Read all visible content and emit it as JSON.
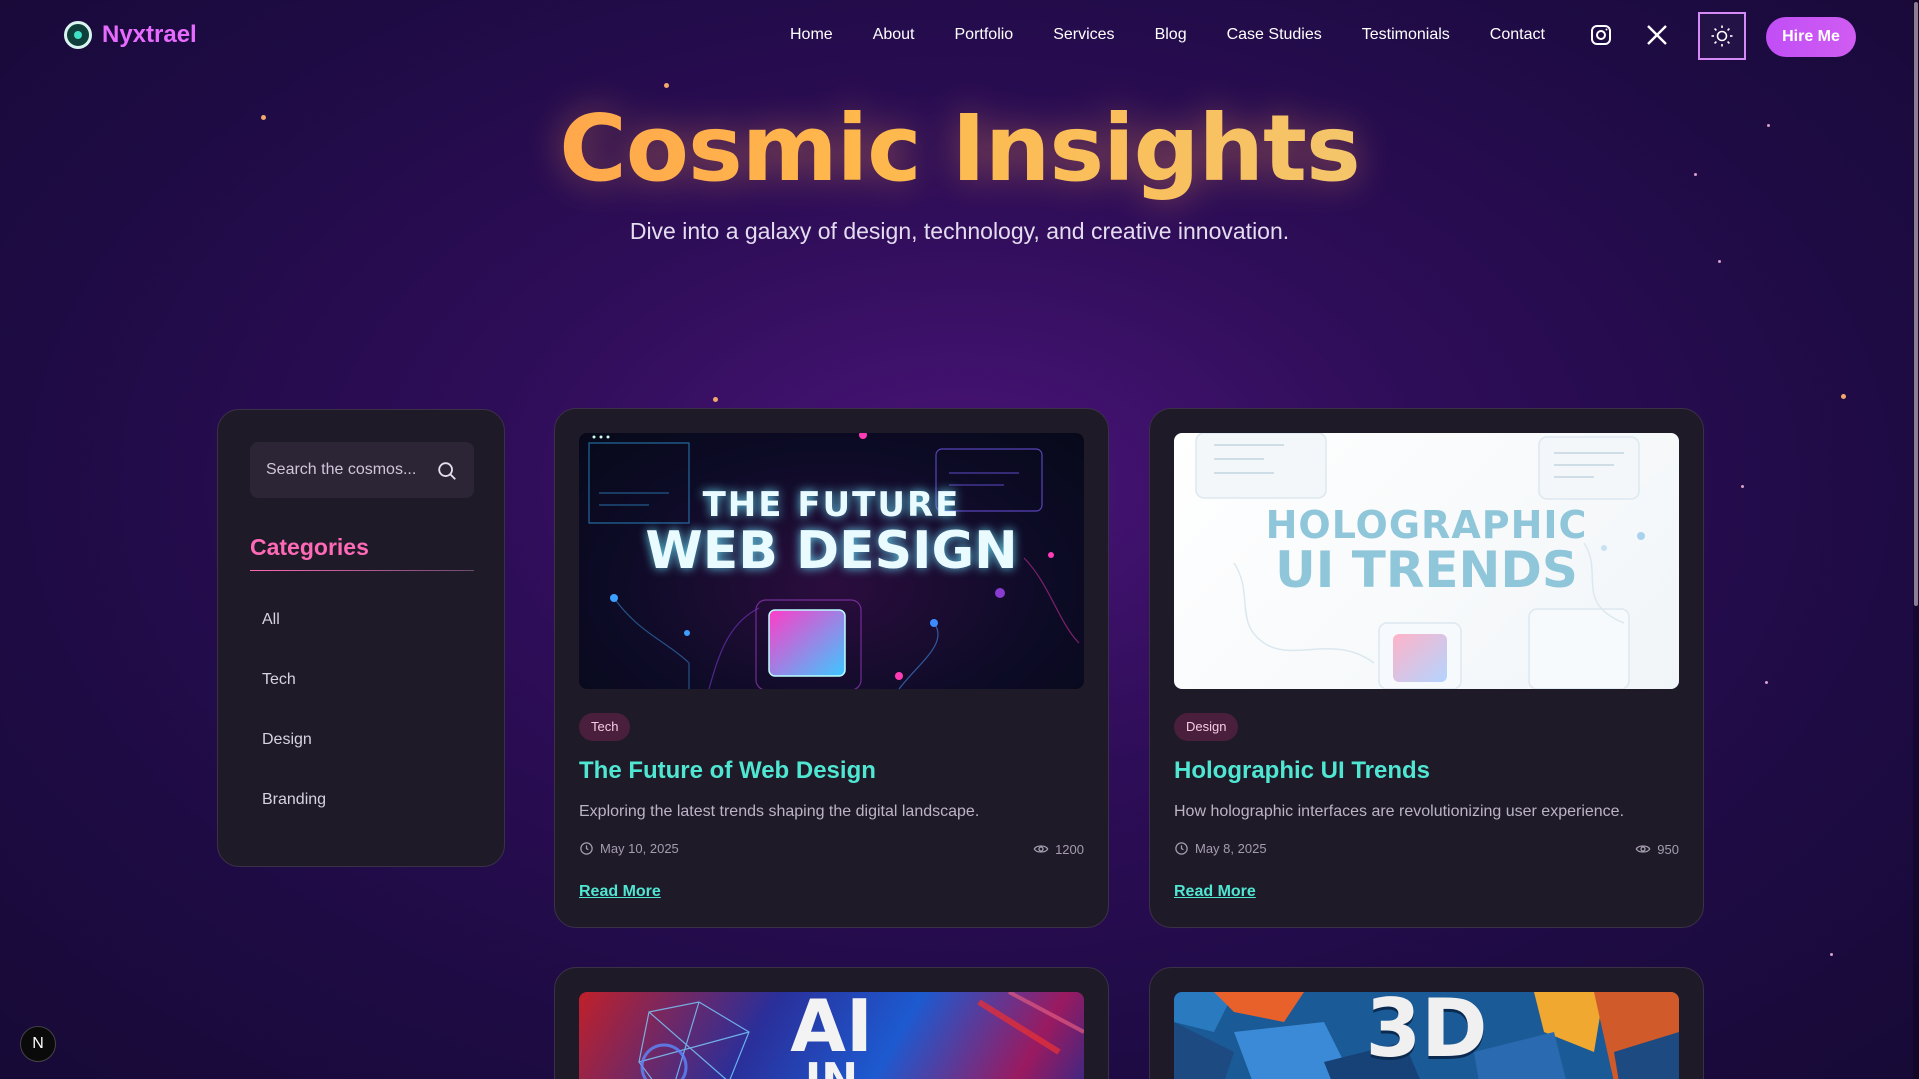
{
  "brand": {
    "name": "Nyxtrael"
  },
  "nav": {
    "links": [
      "Home",
      "About",
      "Portfolio",
      "Services",
      "Blog",
      "Case Studies",
      "Testimonials",
      "Contact"
    ],
    "instagram_icon": "instagram-icon",
    "x_icon": "x-icon",
    "theme_icon": "sun-icon",
    "hire_label": "Hire Me"
  },
  "hero": {
    "title": "Cosmic Insights",
    "subtitle": "Dive into a galaxy of design, technology, and creative innovation."
  },
  "sidebar": {
    "search_placeholder": "Search the cosmos...",
    "categories_title": "Categories",
    "categories": [
      "All",
      "Tech",
      "Design",
      "Branding"
    ]
  },
  "posts": [
    {
      "tag": "Tech",
      "title": "The Future of Web Design",
      "description": "Exploring the latest trends shaping the digital landscape.",
      "date": "May 10, 2025",
      "views": "1200",
      "read_more": "Read More",
      "image_line1": "THE FUTURE",
      "image_line2": "WEB DESIGN"
    },
    {
      "tag": "Design",
      "title": "Holographic UI Trends",
      "description": "How holographic interfaces are revolutionizing user experience.",
      "date": "May 8, 2025",
      "views": "950",
      "read_more": "Read More",
      "image_line1": "HOLOGRAPHIC",
      "image_line2": "UI TRENDS"
    },
    {
      "image_line1": "AI",
      "image_line2": "IN"
    },
    {
      "image_line1": "3D"
    }
  ],
  "dev_badge": "N",
  "colors": {
    "brand": "#e86bff",
    "accent_teal": "#4fe6d2",
    "category_pink": "#ff69b6",
    "hire_button": "#c14ef6"
  }
}
